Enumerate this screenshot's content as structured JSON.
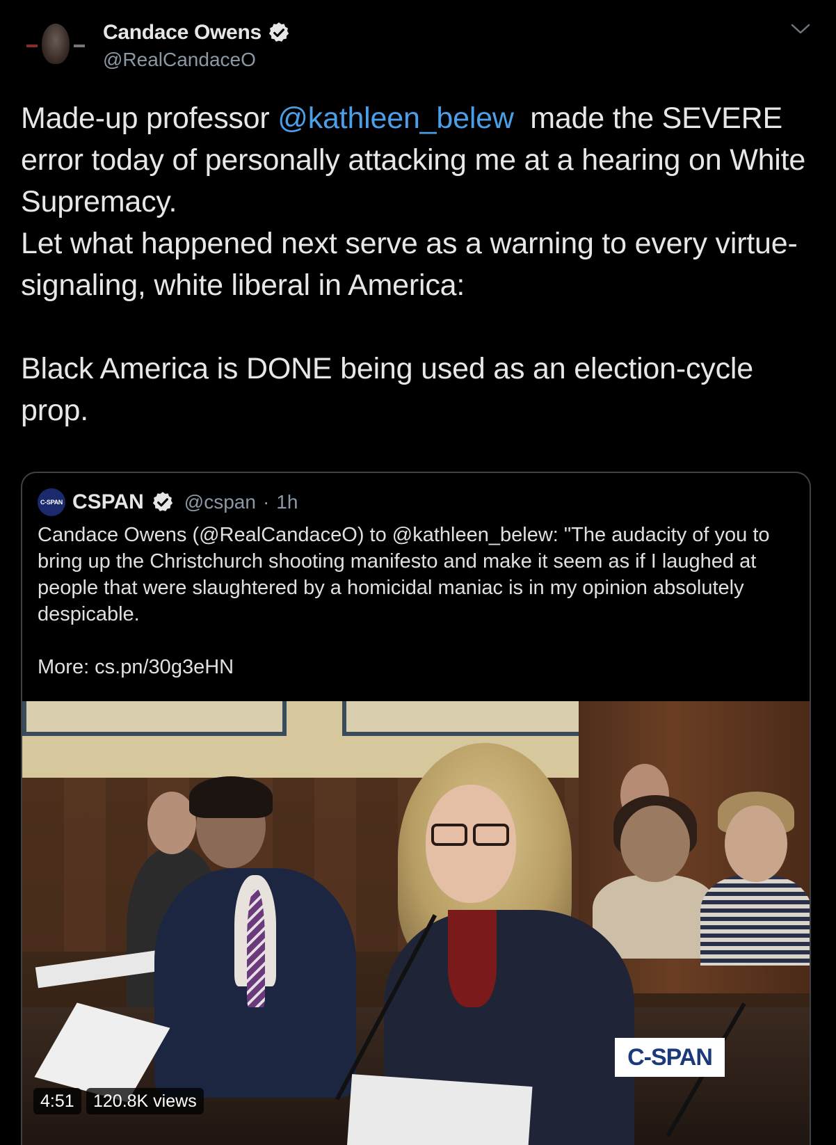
{
  "author": {
    "display_name": "Candace Owens",
    "handle": "@RealCandaceO",
    "verified_icon": "verified-badge-icon"
  },
  "tweet": {
    "text_before_mention": "Made-up professor ",
    "mention": "@kathleen_belew",
    "text_after_mention": "  made the SEVERE error today of personally attacking me at a hearing on White Supremacy.\nLet what happened next serve as a warning to every virtue-signaling, white liberal in America:\n\nBlack America is DONE being used as an election-cycle prop."
  },
  "quoted": {
    "avatar_label": "C-SPAN",
    "display_name": "CSPAN",
    "handle": "@cspan",
    "separator": "·",
    "time": "1h",
    "text": "Candace Owens (@RealCandaceO) to @kathleen_belew: \"The audacity of you to bring up the Christchurch shooting manifesto and make it seem as if I laughed at people that were slaughtered by a homicidal maniac is in my opinion absolutely despicable.\n\nMore: cs.pn/30g3eHN",
    "video": {
      "duration": "4:51",
      "views": "120.8K views",
      "watermark": "C-SPAN"
    }
  },
  "colors": {
    "background": "#000000",
    "link": "#4a9fe8",
    "muted": "#8b98a5",
    "border": "#3d4247"
  }
}
